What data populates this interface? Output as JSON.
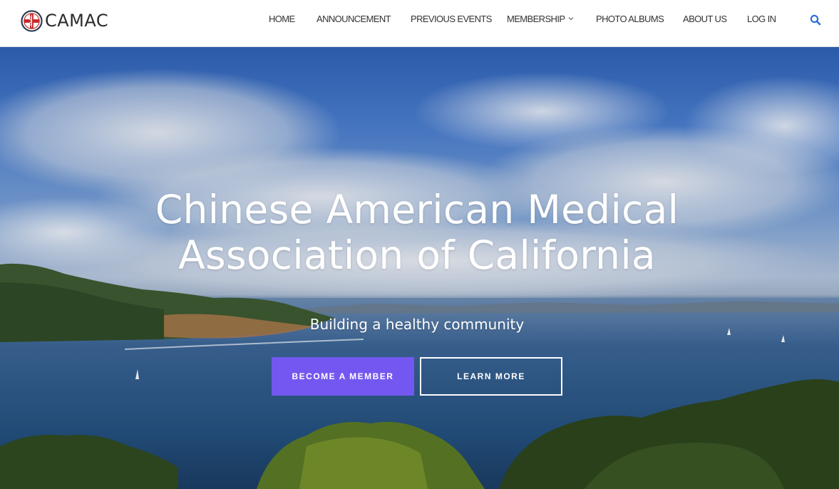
{
  "header": {
    "logo_text": "CAMAC",
    "nav": [
      {
        "label": "HOME"
      },
      {
        "label": "ANNOUNCEMENT"
      },
      {
        "label": "PREVIOUS EVENTS"
      },
      {
        "label": "MEMBERSHIP"
      },
      {
        "label": "PHOTO ALBUMS"
      },
      {
        "label": "ABOUT US"
      },
      {
        "label": "LOG IN"
      }
    ],
    "icons": {
      "search": "search-icon",
      "dropdown": "chevron-down-icon"
    },
    "accent_color": "#2a6fd6"
  },
  "hero": {
    "title_line1": "Chinese American Medical",
    "title_line2": "Association of California",
    "subtitle": "Building a healthy community",
    "primary_button": "BECOME A MEMBER",
    "secondary_button": "LEARN MORE",
    "primary_color": "#7457f0"
  }
}
